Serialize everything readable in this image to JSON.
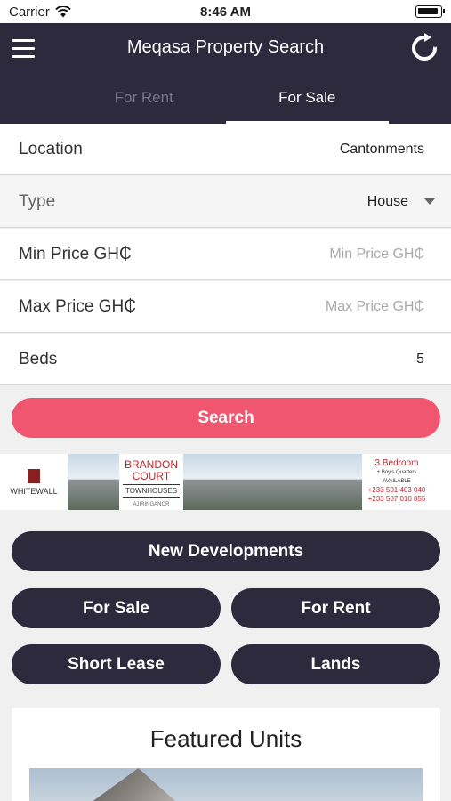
{
  "status": {
    "carrier": "Carrier",
    "time": "8:46 AM"
  },
  "nav": {
    "title": "Meqasa Property Search",
    "tabs": [
      {
        "label": "For Rent"
      },
      {
        "label": "For Sale"
      }
    ]
  },
  "form": {
    "location": {
      "label": "Location",
      "value": "Cantonments"
    },
    "type": {
      "label": "Type",
      "value": "House"
    },
    "min_price": {
      "label": "Min Price GH₵",
      "placeholder": "Min Price GH₵"
    },
    "max_price": {
      "label": "Max Price GH₵",
      "placeholder": "Max Price GH₵"
    },
    "beds": {
      "label": "Beds",
      "value": "5"
    },
    "search_label": "Search"
  },
  "banner": {
    "logo": "WHITEWALL",
    "court_line1": "BRANDON",
    "court_line2": "COURT",
    "court_line3": "TOWNHOUSES",
    "court_line4": "AJIRINGANOR",
    "info_line1": "3 Bedroom",
    "info_line2": "+ Boy's Quarters",
    "info_line3": "AVAILABLE",
    "info_phone1": "+233 501 403 040",
    "info_phone2": "+233 507 010 855"
  },
  "quick_links": {
    "new_developments": "New Developments",
    "for_sale": "For Sale",
    "for_rent": "For Rent",
    "short_lease": "Short Lease",
    "lands": "Lands"
  },
  "featured": {
    "title": "Featured Units"
  },
  "colors": {
    "nav_bg": "#2e2a3e",
    "accent": "#f0566f"
  }
}
